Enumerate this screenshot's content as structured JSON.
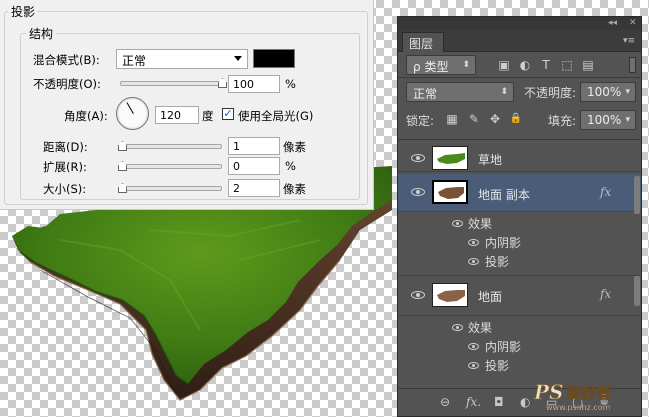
{
  "dialog": {
    "title": "投影",
    "section": "结构",
    "blend_label": "混合模式(B):",
    "blend_value": "正常",
    "shadow_color": "#000000",
    "opacity_label": "不透明度(O):",
    "opacity_value": "100",
    "opacity_unit": "%",
    "opacity_slider": 1.0,
    "angle_label": "角度(A):",
    "angle_value": "120",
    "angle_unit": "度",
    "global_light_label": "使用全局光(G)",
    "global_light_checked": true,
    "global_light_mark": "✓",
    "distance_label": "距离(D):",
    "distance_value": "1",
    "distance_unit": "像素",
    "spread_label": "扩展(R):",
    "spread_value": "0",
    "spread_unit": "%",
    "size_label": "大小(S):",
    "size_value": "2",
    "size_unit": "像素"
  },
  "panel": {
    "topbar_collapse": "◂◂",
    "topbar_close": "✕",
    "tab": "图层",
    "menu": "▾≡",
    "filter_prefix": "ρ",
    "filter_label": "类型",
    "filter_caret": "⬍",
    "blend_mode": "正常",
    "blend_caret": "⬍",
    "opacity_label": "不透明度:",
    "opacity_value": "100%",
    "opacity_caret": "▾",
    "lock_label": "锁定:",
    "fill_label": "填充:",
    "fill_value": "100%",
    "fill_caret": "▾",
    "icons": {
      "image": "▣",
      "adjust": "◐",
      "text": "T",
      "shape": "⬚",
      "smart": "▤",
      "lock_pixels": "▦",
      "lock_paint": "✎",
      "lock_move": "✥",
      "lock_all": "🔒"
    },
    "layers": [
      {
        "name": "草地",
        "fx": ""
      },
      {
        "name": "地面 副本",
        "fx": "fx",
        "effects_label": "效果",
        "effects": [
          "内阴影",
          "投影"
        ]
      },
      {
        "name": "地面",
        "fx": "fx",
        "effects_label": "效果",
        "effects": [
          "内阴影",
          "投影"
        ]
      }
    ],
    "bottom_icons": {
      "link": "⊖",
      "fx": "fx.",
      "mask": "◘",
      "adjust": "◐",
      "folder": "▭",
      "new": "▢",
      "trash": "🗑"
    }
  },
  "watermark": {
    "main": "PS 爱好者",
    "url": "www.psahz.com"
  }
}
